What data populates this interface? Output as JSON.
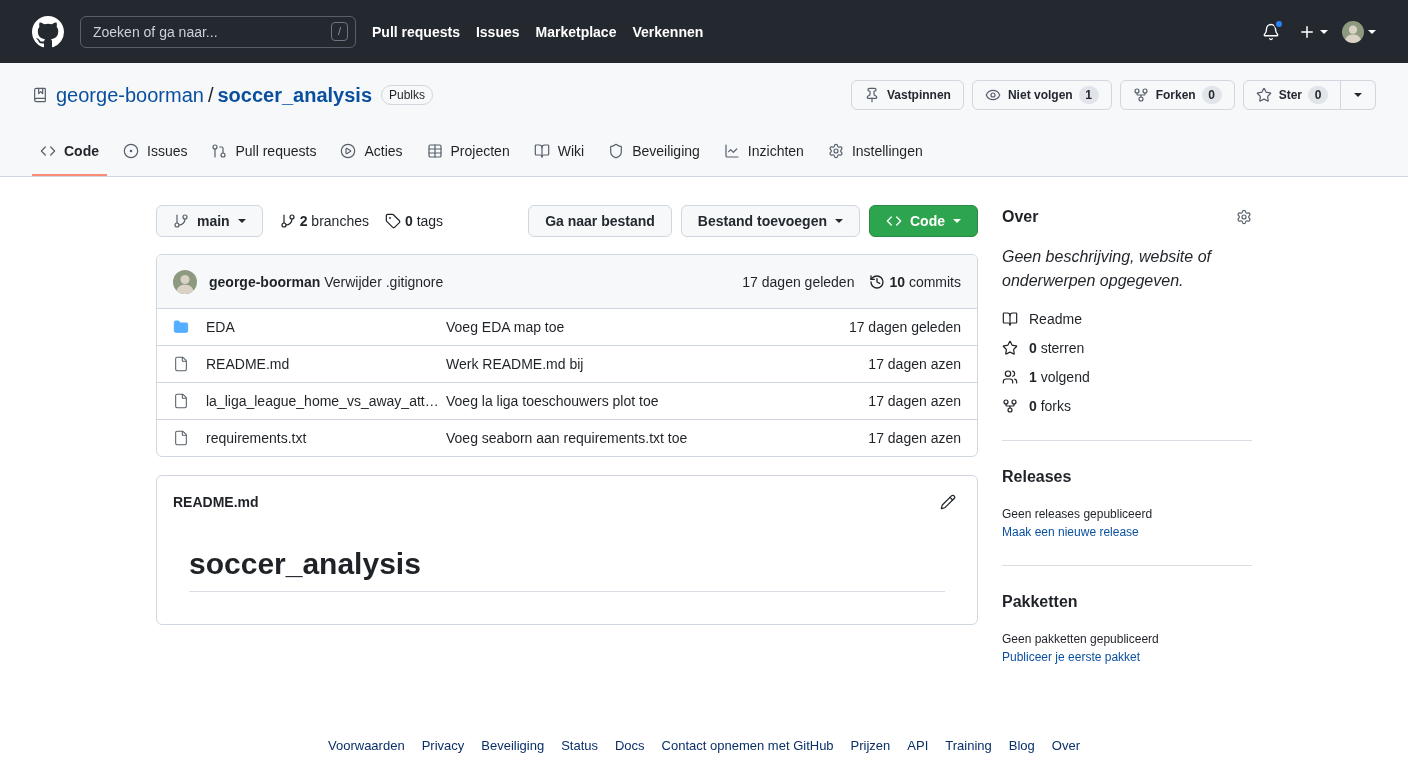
{
  "header": {
    "search": {
      "placeholder": "Zoeken of ga naar...",
      "shortcut": "/"
    },
    "nav": [
      "Pull requests",
      "Issues",
      "Marketplace",
      "Verkennen"
    ],
    "notifications_unread": true
  },
  "repo": {
    "owner": "george-boorman",
    "separator": "/",
    "name": "soccer_analysis",
    "visibility": "Publks",
    "actions": [
      {
        "kind": "pin",
        "label": "Vastpinnen",
        "menu": false
      },
      {
        "kind": "watch",
        "label": "Niet volgen",
        "count": "1",
        "menu": false
      },
      {
        "kind": "fork",
        "label": "Forken",
        "count": "0",
        "menu": false
      },
      {
        "kind": "star",
        "label": "Ster",
        "count": "0",
        "menu": true
      }
    ]
  },
  "tabs": [
    {
      "kind": "code",
      "label": "Code",
      "selected": true
    },
    {
      "kind": "issues",
      "label": "Issues",
      "selected": false
    },
    {
      "kind": "pulls",
      "label": "Pull requests",
      "selected": false
    },
    {
      "kind": "actions",
      "label": "Acties",
      "selected": false
    },
    {
      "kind": "projects",
      "label": "Projecten",
      "selected": false
    },
    {
      "kind": "wiki",
      "label": "Wiki",
      "selected": false
    },
    {
      "kind": "security",
      "label": "Beveiliging",
      "selected": false
    },
    {
      "kind": "insights",
      "label": "Inzichten",
      "selected": false
    },
    {
      "kind": "settings",
      "label": "Instellingen",
      "selected": false
    }
  ],
  "branch_bar": {
    "branch": "main",
    "branches": "**2** branches",
    "tags": "**0** tags",
    "buttons": [
      {
        "kind": "plain",
        "label": "Ga naar bestand"
      },
      {
        "kind": "dropdown",
        "label": "Bestand toevoegen"
      },
      {
        "kind": "code",
        "label": "Code"
      }
    ]
  },
  "commit": {
    "author": "george-boorman",
    "message": "Verwijder .gitignore",
    "time": "17 dagen geleden",
    "commits": "**10** commits"
  },
  "files": [
    {
      "kind": "folder",
      "name": "EDA",
      "message": "Voeg EDA map toe",
      "time": "17 dagen geleden"
    },
    {
      "kind": "file",
      "name": "README.md",
      "message": "Werk README.md bij",
      "time": "17 dagen azen"
    },
    {
      "kind": "file",
      "name": "la_liga_league_home_vs_away_att…",
      "message": "Voeg la liga toeschouwers plot toe",
      "time": "17 dagen azen"
    },
    {
      "kind": "file",
      "name": "requirements.txt",
      "message": "Voeg seaborn aan requirements.txt toe",
      "time": "17 dagen azen"
    }
  ],
  "readme": {
    "filename": "README.md",
    "title": "soccer_analysis"
  },
  "about": {
    "heading": "Over",
    "description": "Geen beschrijving, website of onderwerpen opgegeven.",
    "items": [
      {
        "kind": "readme",
        "label": "Readme"
      },
      {
        "kind": "stars",
        "label": "**0** sterren"
      },
      {
        "kind": "watchers",
        "label": "**1** volgend"
      },
      {
        "kind": "forks",
        "label": "**0** forks"
      }
    ]
  },
  "releases": {
    "heading": "Releases",
    "text": "Geen releases gepubliceerd",
    "link": "Maak een nieuwe release"
  },
  "packages": {
    "heading": "Pakketten",
    "text": "Geen pakketten gepubliceerd",
    "link": "Publiceer je eerste pakket"
  },
  "footer": {
    "links": [
      "Voorwaarden",
      "Privacy",
      "Beveiliging",
      "Status",
      "Docs",
      "Contact opnemen met GitHub",
      "Prijzen",
      "API",
      "Training",
      "Blog",
      "Over"
    ]
  }
}
